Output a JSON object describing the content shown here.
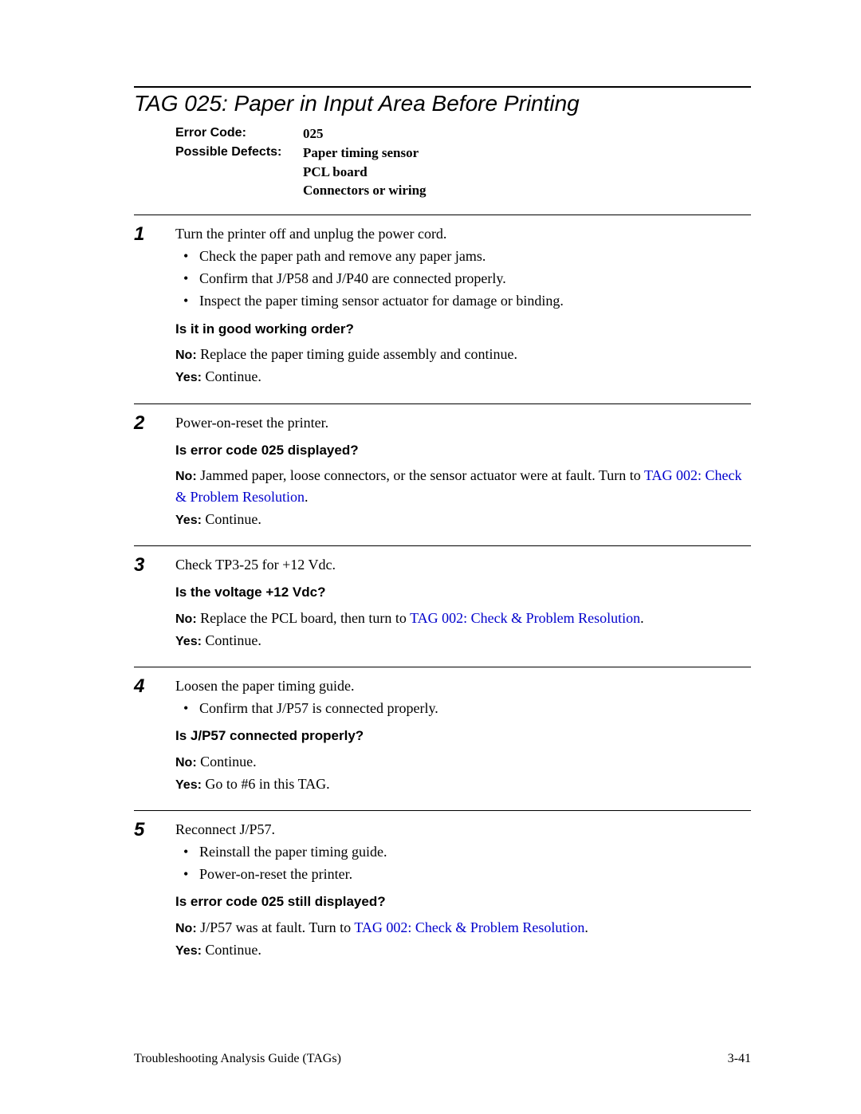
{
  "title": "TAG 025: Paper in Input Area Before Printing",
  "meta": {
    "error_code_label": "Error Code:",
    "error_code_value": "025",
    "possible_defects_label": "Possible Defects:",
    "defects": [
      "Paper timing sensor",
      "PCL board",
      "Connectors or wiring"
    ]
  },
  "steps": [
    {
      "num": "1",
      "intro": "Turn the printer off and unplug the power cord.",
      "bullets": [
        "Check the paper path and remove any paper jams.",
        "Confirm that J/P58 and J/P40 are connected properly.",
        "Inspect the paper timing sensor actuator for damage or binding."
      ],
      "question": "Is it in good working order?",
      "no_label": "No:",
      "no_text": "  Replace the paper timing guide assembly and continue.",
      "yes_label": "Yes:",
      "yes_text": " Continue."
    },
    {
      "num": "2",
      "intro": "Power-on-reset the printer.",
      "question": "Is error code 025 displayed?",
      "no_label": "No:",
      "no_text_prefix": "  Jammed paper, loose connectors, or the sensor actuator were at fault. Turn to ",
      "no_link": "TAG 002: Check & Problem Resolution",
      "no_text_suffix": ".",
      "yes_label": "Yes:",
      "yes_text": " Continue."
    },
    {
      "num": "3",
      "intro": "Check TP3-25 for +12 Vdc.",
      "question": "Is the voltage +12 Vdc?",
      "no_label": "No:",
      "no_text_prefix": "  Replace the PCL board, then turn to ",
      "no_link": "TAG 002: Check & Problem Resolution",
      "no_text_suffix": ".",
      "yes_label": "Yes:",
      "yes_text": " Continue."
    },
    {
      "num": "4",
      "intro": "Loosen the paper timing guide.",
      "bullets": [
        "Confirm that J/P57 is connected properly."
      ],
      "question": "Is J/P57 connected properly?",
      "no_label": "No:",
      "no_text": "  Continue.",
      "yes_label": "Yes:",
      "yes_text": " Go to #6 in this TAG."
    },
    {
      "num": "5",
      "intro": "Reconnect J/P57.",
      "bullets": [
        "Reinstall the paper timing guide.",
        "Power-on-reset the printer."
      ],
      "question": "Is error code 025 still displayed?",
      "no_label": "No:",
      "no_text_prefix": "  J/P57 was at fault. Turn to ",
      "no_link": "TAG 002: Check & Problem Resolution",
      "no_text_suffix": ".",
      "yes_label": "Yes:",
      "yes_text": " Continue."
    }
  ],
  "footer": {
    "left": "Troubleshooting Analysis Guide (TAGs)",
    "right": "3-41"
  }
}
